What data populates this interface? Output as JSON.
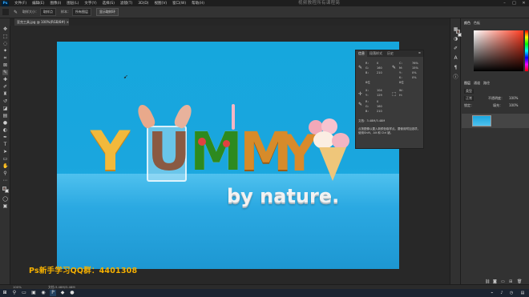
{
  "menu": {
    "logo": "Ps",
    "items": [
      "文件(F)",
      "编辑(E)",
      "图像(I)",
      "图层(L)",
      "文字(Y)",
      "选择(S)",
      "滤镜(T)",
      "3D(D)",
      "视图(V)",
      "窗口(W)",
      "帮助(H)"
    ],
    "window_title": "视频教程所有课程简"
  },
  "options_bar": {
    "sample_size_label": "取样大小：",
    "sample_size_value": "取样点",
    "sample_label": "样本：",
    "sample_value": "所有图层",
    "show_ring": "显示取样环"
  },
  "document_tab": {
    "title": "亚克工具.jpg @ 100%(RGB/8#) ×"
  },
  "artwork": {
    "letters": [
      "Y",
      "U",
      "M",
      "M",
      "Y"
    ],
    "tagline": "by nature."
  },
  "overlay": {
    "qq_text": "Ps新手学习QQ群：4401308"
  },
  "info_panel": {
    "tabs": [
      "信息",
      "段落样式",
      "历史"
    ],
    "rgb_labels": [
      "R：",
      "G：",
      "B："
    ],
    "rgb_values": [
      "0",
      "160",
      "210"
    ],
    "cmyk_labels": [
      "C：",
      "M：",
      "Y：",
      "K："
    ],
    "cmyk_values": [
      "76%",
      "15%",
      "0%",
      "0%"
    ],
    "bit_depth": "8位",
    "xy_labels": [
      "X：",
      "Y："
    ],
    "xy_values": [
      "104",
      "129"
    ],
    "wh_labels": [
      "W：",
      "H："
    ],
    "doc_size": "文档：3.48M/3.48M",
    "hint": "点按图像以置入新颜色取样点。要使用附加选项，使用Shift、Alt 和 Ctrl 键。"
  },
  "right_dock": {
    "color_tabs": [
      "颜色",
      "色板"
    ],
    "color_accent": "#ff3b1f",
    "panel_tabs": [
      "图层",
      "通道",
      "路径"
    ],
    "kind_label": "类型",
    "blend_mode": "正常",
    "opacity_label": "不透明度：",
    "opacity_value": "100%",
    "lock_label": "锁定：",
    "fill_label": "填充：",
    "fill_value": "100%",
    "layer_name": "背景"
  },
  "status_bar": {
    "zoom": "100%",
    "doc_info": "文档:3.48M/3.48M"
  }
}
